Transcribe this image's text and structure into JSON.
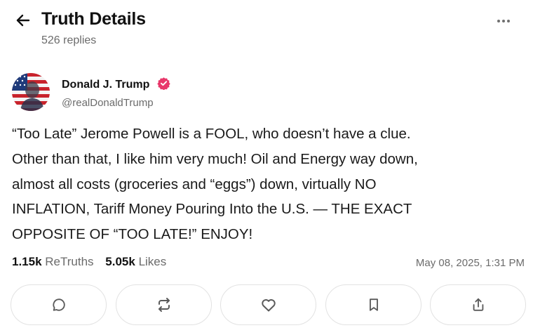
{
  "header": {
    "title": "Truth Details",
    "subtitle": "526 replies",
    "back_icon": "arrow-left-icon",
    "more_icon": "more-horizontal-icon"
  },
  "post": {
    "author_name": "Donald J. Trump",
    "author_handle": "@realDonaldTrump",
    "verified_color": "#e8386b",
    "text": "“Too Late” Jerome Powell is a FOOL, who doesn’t have a clue.\nOther than that, I like him very much! Oil and Energy way down,\nalmost all costs (groceries and “eggs”) down, virtually NO\nINFLATION, Tariff Money Pouring Into the U.S. — THE EXACT\nOPPOSITE OF “TOO LATE!” ENJOY!",
    "retruths_count": "1.15k",
    "retruths_label": "ReTruths",
    "likes_count": "5.05k",
    "likes_label": "Likes",
    "timestamp": "May 08, 2025, 1:31 PM"
  },
  "actions": [
    {
      "icon": "reply-icon"
    },
    {
      "icon": "retruth-icon"
    },
    {
      "icon": "like-icon"
    },
    {
      "icon": "bookmark-icon"
    },
    {
      "icon": "share-icon"
    }
  ],
  "colors": {
    "text_primary": "#111111",
    "text_secondary": "#6b6b6b",
    "border": "#e2e2e2",
    "icon": "#5a5a5a"
  }
}
